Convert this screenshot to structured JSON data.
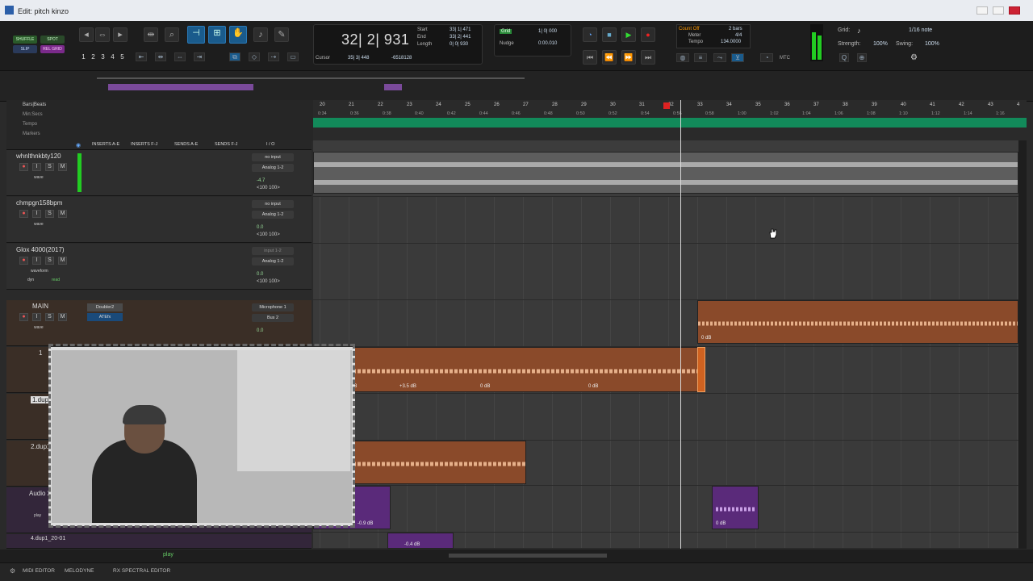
{
  "window": {
    "title": "Edit: pitch kinzo"
  },
  "toolbar": {
    "modes": [
      "SHUFFLE",
      "SPOT",
      "SLIP",
      "REL GRID"
    ],
    "zoom_presets": [
      "1",
      "2",
      "3",
      "4",
      "5"
    ],
    "counter": {
      "main": "32| 2| 931",
      "start_label": "Start",
      "start_val": "33| 1| 471",
      "end_label": "End",
      "end_val": "33| 2| 441",
      "length_label": "Length",
      "length_val": "0| 0| 930",
      "cursor_label": "Cursor",
      "cursor_val": "35| 3| 448",
      "cursor_sample": "-6518128"
    },
    "grid": {
      "label": "Grid",
      "value": "1| 0| 000",
      "nudge_label": "Nudge",
      "nudge_value": "0:00.010"
    },
    "countoff": {
      "label": "Count Off",
      "bars": "2 bars",
      "meter_label": "Meter",
      "meter_value": "4/4",
      "tempo_label": "Tempo",
      "tempo_value": "134.0000"
    },
    "grid_panel": {
      "grid_label": "Grid:",
      "note": "1/16 note",
      "strength_label": "Strength:",
      "strength": "100%",
      "swing_label": "Swing:",
      "swing": "100%"
    },
    "mtc": "MTC"
  },
  "rulers": {
    "bars_label": "Bars|Beats",
    "minsec_label": "Min:Secs",
    "tempo_label": "Tempo",
    "markers_label": "Markers",
    "bars": [
      "20",
      "21",
      "22",
      "23",
      "24",
      "25",
      "26",
      "27",
      "28",
      "29",
      "30",
      "31",
      "32",
      "33",
      "34",
      "35",
      "36",
      "37",
      "38",
      "39",
      "40",
      "41",
      "42",
      "43",
      "4"
    ],
    "times": [
      "0:34",
      "0:36",
      "0:38",
      "0:40",
      "0:42",
      "0:44",
      "0:46",
      "0:48",
      "0:50",
      "0:52",
      "0:54",
      "0:56",
      "0:58",
      "1:00",
      "1:02",
      "1:04",
      "1:06",
      "1:08",
      "1:10",
      "1:12",
      "1:14",
      "1:16"
    ]
  },
  "columns": {
    "inserts_ae": "INSERTS A-E",
    "inserts_fj": "INSERTS F-J",
    "sends_ae": "SENDS A-E",
    "sends_fj": "SENDS F-J",
    "io": "I / O"
  },
  "tracks": [
    {
      "name": "whnlthnkbty120",
      "in": "no input",
      "out": "Analog 1-2",
      "vol": "-4.7",
      "pan": "<100  100>",
      "mode": "wave"
    },
    {
      "name": "chmpgn158bpm",
      "in": "no input",
      "out": "Analog 1-2",
      "vol": "0.0",
      "pan": "<100  100>",
      "mode": "wave"
    },
    {
      "name": "Glox 4000(2017)",
      "in": "input 1-2",
      "out": "Analog 1-2",
      "vol": "0.0",
      "pan": "<100  100>",
      "mode": "waveform",
      "auto": "dyn",
      "read": "read"
    },
    {
      "name": "MAIN",
      "in": "Microphone 1",
      "out": "Bus 2",
      "vol": "0.0",
      "insert1": "Doubler2",
      "insert2": "ATEfx",
      "mode": "wave"
    },
    {
      "name": "1",
      "mode": "wave"
    },
    {
      "name": "1.dup1",
      "mode": "wave"
    },
    {
      "name": "2.dup1",
      "mode": "wave"
    },
    {
      "name": "Audio 2",
      "mode": "play"
    },
    {
      "name": "4.dup1_20-01",
      "mode": "play"
    }
  ],
  "clips": {
    "main_gain": "0 dB",
    "t1_gains": [
      "dB",
      "+3.5 dB",
      "0 dB",
      "0 dB"
    ],
    "audio2_gains": [
      "-0.9 dB",
      "0 dB"
    ],
    "dup_gain": "-0.4 dB"
  },
  "bottom": {
    "play": "play"
  },
  "status_tabs": [
    "MIDI EDITOR",
    "MELODYNE",
    "RX SPECTRAL EDITOR"
  ]
}
